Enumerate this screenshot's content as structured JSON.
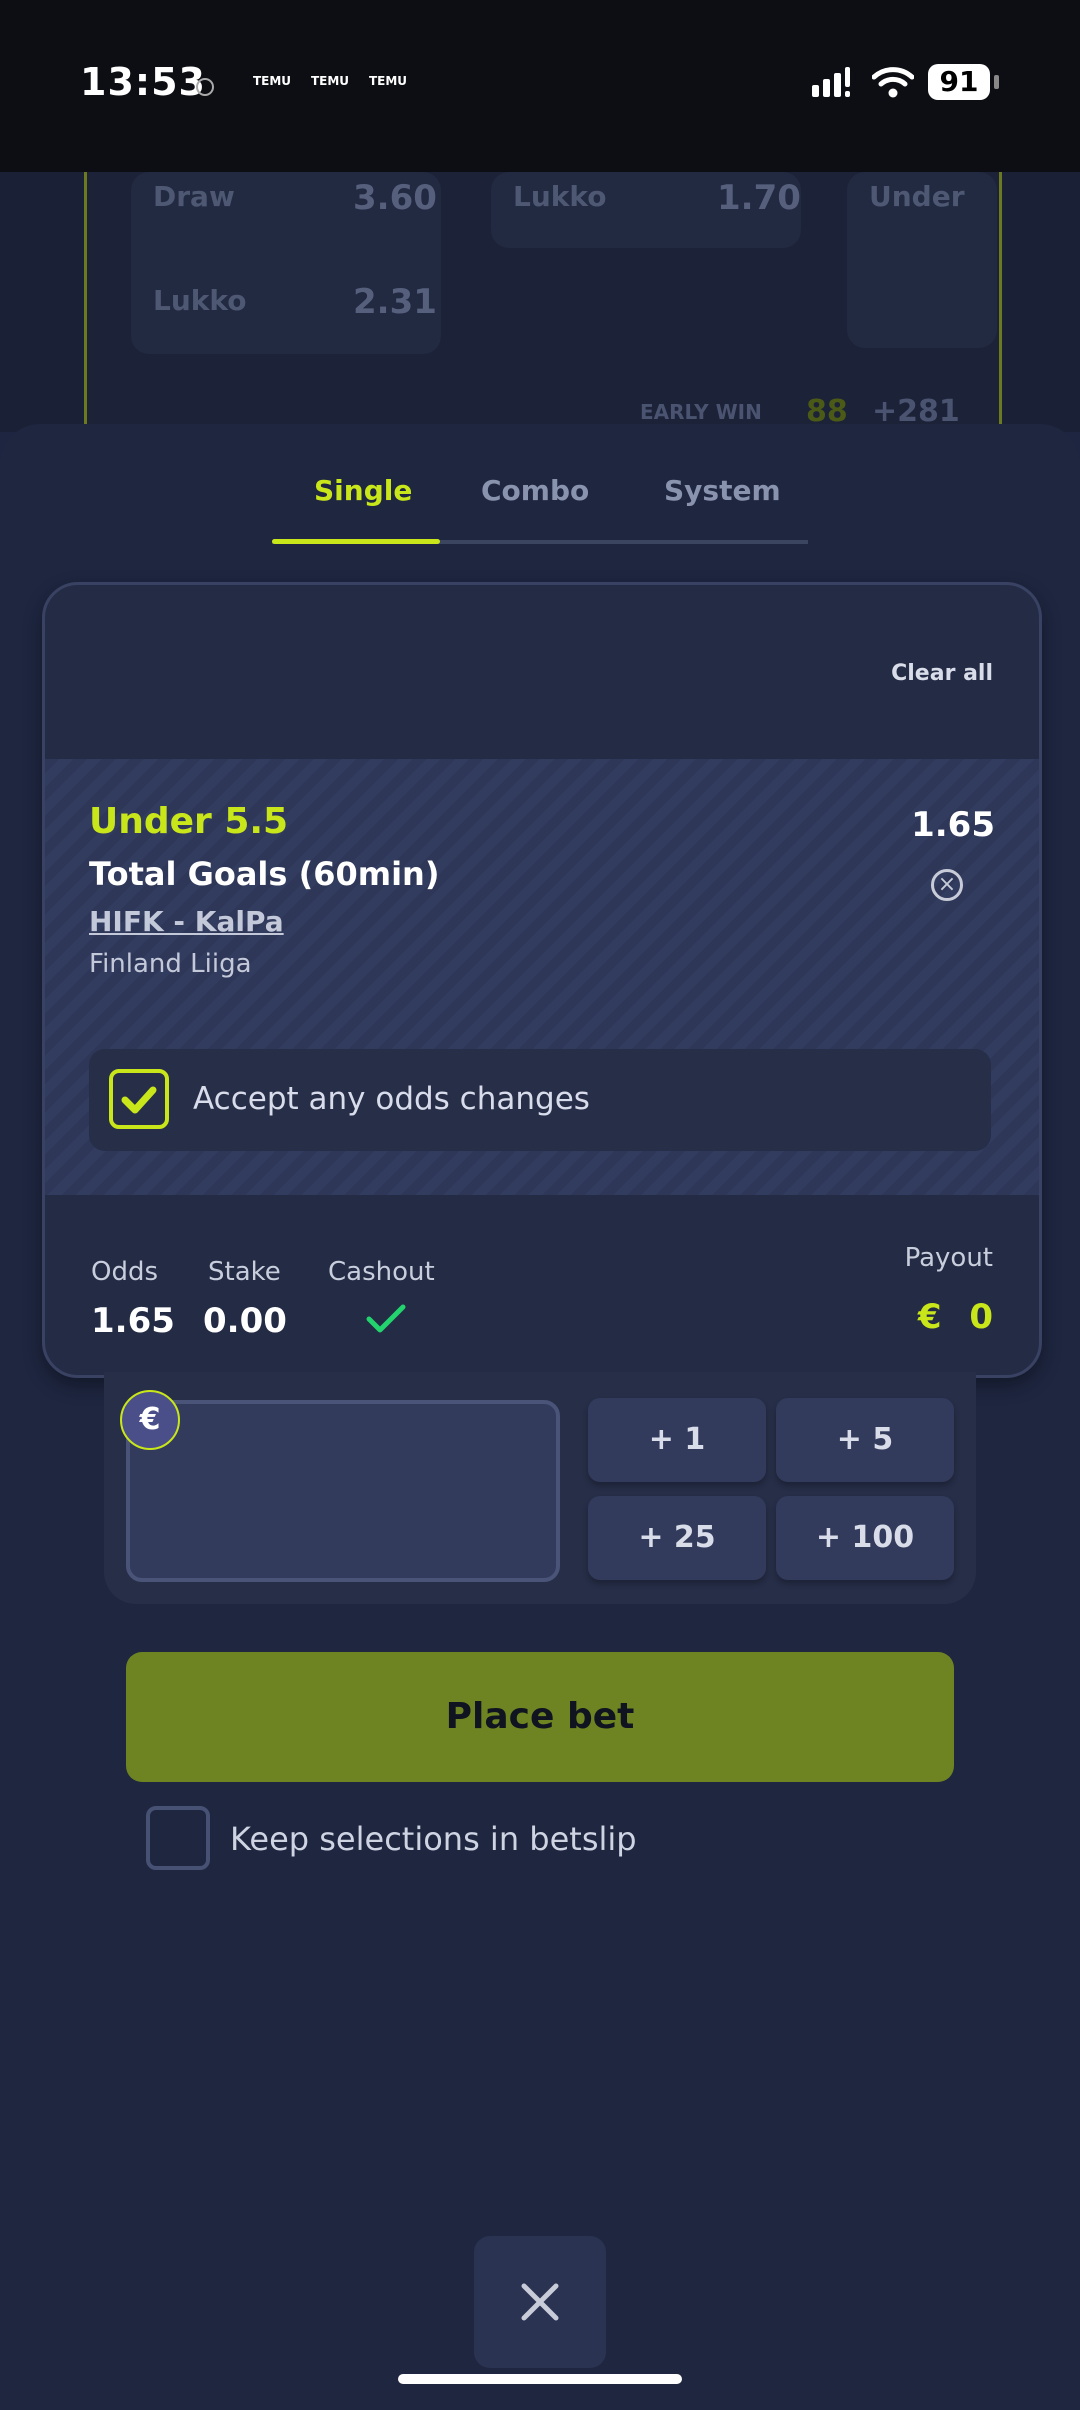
{
  "status_bar": {
    "time": "13:53",
    "notifications": [
      "TEMU",
      "TEMU",
      "TEMU"
    ],
    "battery": "91"
  },
  "background": {
    "rows": [
      {
        "label": "Draw",
        "value": "3.60"
      },
      {
        "label": "Lukko",
        "value": "2.31"
      },
      {
        "label": "Lukko",
        "value": "1.70"
      },
      {
        "label": "Under",
        "value": ""
      }
    ],
    "early_win_label": "EARLY WIN",
    "early_win_badge": "88",
    "early_win_more": "+281"
  },
  "tabs": [
    {
      "label": "Single",
      "active": true
    },
    {
      "label": "Combo",
      "active": false
    },
    {
      "label": "System",
      "active": false
    }
  ],
  "betslip": {
    "clear_all": "Clear all",
    "selection": {
      "market": "Under 5.5",
      "type": "Total Goals (60min)",
      "match": "HIFK - KalPa",
      "league": "Finland Liiga",
      "odds": "1.65"
    },
    "accept_odds_label": "Accept any odds changes",
    "accept_odds_checked": true,
    "summary": {
      "odds_label": "Odds",
      "odds_value": "1.65",
      "stake_label": "Stake",
      "stake_value": "0.00",
      "cashout_label": "Cashout",
      "payout_label": "Payout",
      "payout_currency": "€",
      "payout_value": "0"
    }
  },
  "stake_panel": {
    "currency_symbol": "€",
    "quick_amounts": [
      "+ 1",
      "+ 5",
      "+ 25",
      "+ 100"
    ]
  },
  "actions": {
    "place_bet": "Place bet",
    "keep_selections": "Keep selections in betslip",
    "keep_selections_checked": false
  },
  "colors": {
    "accent": "#c8e61a",
    "place_bet": "#6e8423",
    "cashout_check": "#22d36e",
    "sheet_bg": "#1e2640"
  }
}
